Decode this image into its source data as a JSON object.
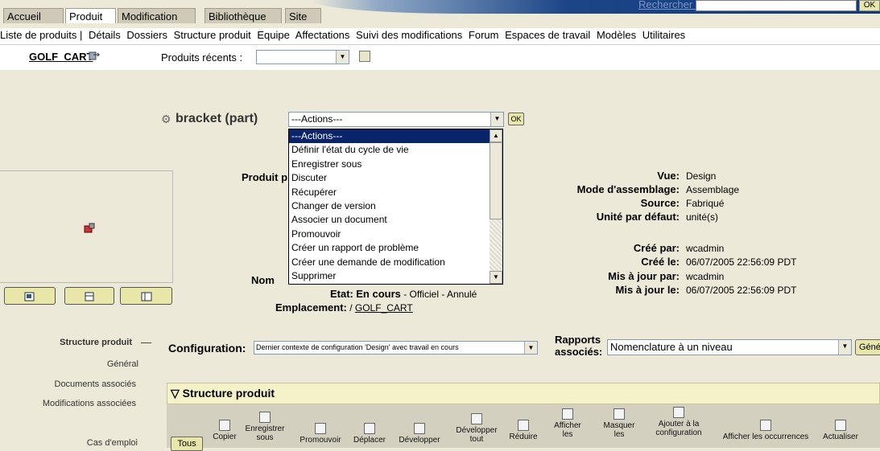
{
  "top_tabs": [
    "Accueil",
    "Produit",
    "Modification",
    "Bibliothèque",
    "Site"
  ],
  "active_tab": "Produit",
  "search_link": "Rechercher :",
  "ok_top": "OK",
  "submenu": [
    "Liste de produits |",
    "Détails",
    "Dossiers",
    "Structure produit",
    "Equipe",
    "Affectations",
    "Suivi des modifications",
    "Forum",
    "Espaces de travail",
    "Modèles",
    "Utilitaires"
  ],
  "context": {
    "name": "GOLF_CART",
    "recent_label": "Produits récents :"
  },
  "object": {
    "title": "bracket (part)",
    "actions_selected": "---Actions---",
    "ok": "OK",
    "actions_options": [
      "---Actions---",
      "Définir l'état du cycle de vie",
      "Enregistrer sous",
      "Discuter",
      "Récupérer",
      "Changer de version",
      "Associer un document",
      "Promouvoir",
      "Créer un rapport de problème",
      "Créer une demande de modification",
      "Supprimer"
    ]
  },
  "props_left": {
    "produit_label": "Produit p",
    "nom_label": "Nom",
    "etat_label": "Etat:",
    "etat_value": "En cours",
    "etat_rest": " - Officiel - Annulé",
    "emplacement_label": "Emplacement:",
    "emplacement_prefix": "/ ",
    "emplacement_link": "GOLF_CART"
  },
  "props_right": [
    {
      "label": "Vue:",
      "value": "Design"
    },
    {
      "label": "Mode d'assemblage:",
      "value": "Assemblage"
    },
    {
      "label": "Source:",
      "value": "Fabriqué"
    },
    {
      "label": "Unité par défaut:",
      "value": "unité(s)"
    },
    {
      "label": "Créé par:",
      "value": "wcadmin"
    },
    {
      "label": "Créé le:",
      "value": "06/07/2005 22:56:09 PDT"
    },
    {
      "label": "Mis à jour par:",
      "value": "wcadmin"
    },
    {
      "label": "Mis à jour le:",
      "value": "06/07/2005 22:56:09 PDT"
    }
  ],
  "left_nav": {
    "structure": "Structure produit",
    "structure_dash": "—",
    "general": "Général",
    "docs": "Documents associés",
    "mods": "Modifications associées",
    "usage": "Cas d'emploi"
  },
  "configuration": {
    "label": "Configuration:",
    "value": "Dernier contexte de configuration 'Design' avec travail en cours",
    "rapports_label_1": "Rapports",
    "rapports_label_2": "associés:",
    "rapports_value": "Nomenclature à un niveau",
    "gen_button": "Géné"
  },
  "structure_panel": {
    "header": "Structure produit",
    "tous": "Tous",
    "tools": [
      {
        "l1": "Copier",
        "l2": ""
      },
      {
        "l1": "Enregistrer",
        "l2": "sous"
      },
      {
        "l1": "Promouvoir",
        "l2": ""
      },
      {
        "l1": "Déplacer",
        "l2": ""
      },
      {
        "l1": "Développer",
        "l2": ""
      },
      {
        "l1": "Développer",
        "l2": "tout"
      },
      {
        "l1": "Réduire",
        "l2": ""
      },
      {
        "l1": "Afficher",
        "l2": "les"
      },
      {
        "l1": "Masquer",
        "l2": "les"
      },
      {
        "l1": "Ajouter à la",
        "l2": "configuration"
      },
      {
        "l1": "Afficher les occurrences",
        "l2": ""
      },
      {
        "l1": "Actualiser",
        "l2": ""
      }
    ]
  }
}
